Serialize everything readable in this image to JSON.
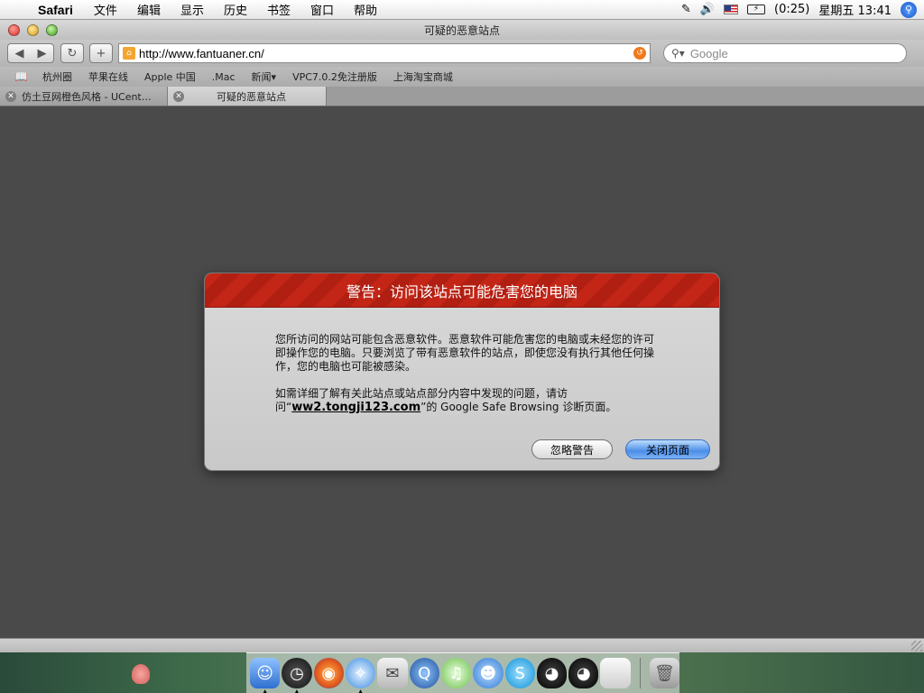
{
  "menubar": {
    "app": "Safari",
    "items": [
      "文件",
      "编辑",
      "显示",
      "历史",
      "书签",
      "窗口",
      "帮助"
    ],
    "status": {
      "battery": "(0:25)",
      "clock": "星期五 13:41"
    }
  },
  "window": {
    "title": "可疑的恶意站点"
  },
  "toolbar": {
    "url": "http://www.fantuaner.cn/",
    "search_placeholder": "Google"
  },
  "bookmarks": [
    "杭州圈",
    "苹果在线",
    "Apple 中国",
    ".Mac",
    "新闻▾",
    "VPC7.0.2免注册版",
    "上海淘宝商城"
  ],
  "tabs": [
    {
      "label": "仿土豆网橙色风格 - UCent…"
    },
    {
      "label": "可疑的恶意站点"
    }
  ],
  "dialog": {
    "title": "警告：访问该站点可能危害您的电脑",
    "p1": "您所访问的网站可能包含恶意软件。恶意软件可能危害您的电脑或未经您的许可即操作您的电脑。只要浏览了带有恶意软件的站点，即使您没有执行其他任何操作，您的电脑也可能被感染。",
    "p2_pre": "如需详细了解有关此站点或站点部分内容中发现的问题，请访问",
    "p2_quote_open": "“",
    "link": "ww2.tongji123.com",
    "p2_post": "”的 Google Safe Browsing 诊断页面。",
    "ignore_button": "忽略警告",
    "close_button": "关闭页面"
  },
  "dock": [
    "finder-icon",
    "dashboard-icon",
    "firefox-icon",
    "safari-icon",
    "mail-icon",
    "quicktime-icon",
    "itunes-icon",
    "msn-icon",
    "skype-icon",
    "qq-icon",
    "qq-icon",
    "apple-icon",
    "trash-icon"
  ]
}
